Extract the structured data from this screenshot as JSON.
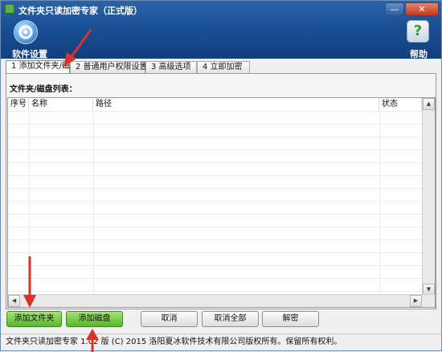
{
  "window": {
    "title": "文件夹只读加密专家（正式版）",
    "minimize_label": "—",
    "close_label": "✕"
  },
  "toolbar": {
    "settings_label": "软件设置",
    "help_label": "帮助",
    "help_glyph": "?"
  },
  "tabs": [
    {
      "label": "1 添加文件夹/磁盘",
      "active": true
    },
    {
      "label": "2 普通用户权限设置",
      "active": false
    },
    {
      "label": "3 高级选项",
      "active": false
    },
    {
      "label": "4 立即加密",
      "active": false
    }
  ],
  "list": {
    "title": "文件夹/磁盘列表：",
    "columns": [
      "序号",
      "名称",
      "路径",
      "状态"
    ],
    "rows": []
  },
  "buttons": {
    "add_folder": "添加文件夹",
    "add_disk": "添加磁盘",
    "cancel": "取消",
    "cancel_all": "取消全部",
    "decrypt": "解密"
  },
  "status_bar": {
    "text": "文件夹只读加密专家 1.02 版 (C) 2015 洛阳夏冰软件技术有限公司版权所有。保留所有权利。"
  },
  "colors": {
    "header_blue": "#1a4f95",
    "accent_green": "#58b52b",
    "annotation_red": "#d9322a"
  }
}
